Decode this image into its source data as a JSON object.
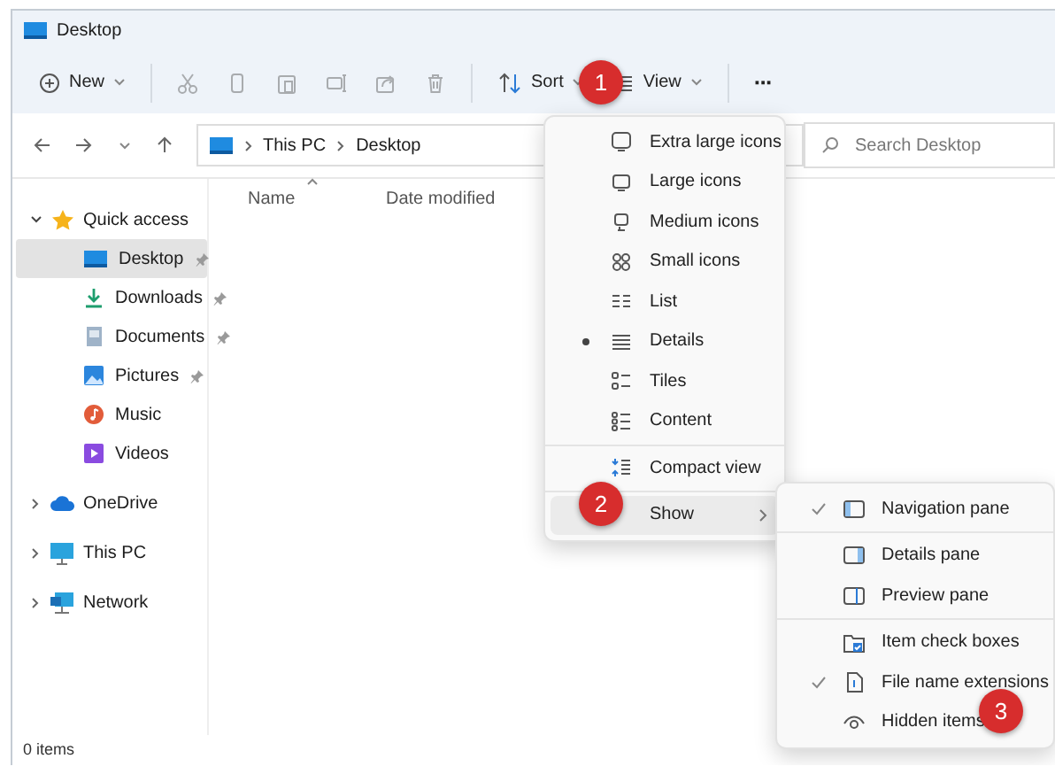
{
  "window": {
    "title": "Desktop"
  },
  "toolbar": [
    {
      "kind": "new",
      "label": "New",
      "disabled": false
    },
    {
      "kind": "cut",
      "disabled": true
    },
    {
      "kind": "copy",
      "disabled": true
    },
    {
      "kind": "paste",
      "disabled": true
    },
    {
      "kind": "rename",
      "disabled": true
    },
    {
      "kind": "share",
      "disabled": true
    },
    {
      "kind": "delete",
      "disabled": true
    },
    {
      "kind": "sort",
      "label": "Sort",
      "disabled": false
    },
    {
      "kind": "view",
      "label": "View",
      "disabled": false
    },
    {
      "kind": "more",
      "label": "···",
      "disabled": false
    }
  ],
  "address": {
    "path": [
      "This PC",
      "Desktop"
    ]
  },
  "search": {
    "placeholder": "Search Desktop"
  },
  "sidebar": {
    "items": [
      {
        "label": "Quick access",
        "expanded": true,
        "children": [
          {
            "label": "Desktop",
            "selected": true,
            "pinned": true
          },
          {
            "label": "Downloads",
            "selected": false,
            "pinned": true
          },
          {
            "label": "Documents",
            "selected": false,
            "pinned": true
          },
          {
            "label": "Pictures",
            "selected": false,
            "pinned": true
          },
          {
            "label": "Music",
            "selected": false,
            "pinned": false
          },
          {
            "label": "Videos",
            "selected": false,
            "pinned": false
          }
        ]
      },
      {
        "label": "OneDrive",
        "expanded": false
      },
      {
        "label": "This PC",
        "expanded": false
      },
      {
        "label": "Network",
        "expanded": false
      }
    ]
  },
  "columns": [
    "Name",
    "Date modified"
  ],
  "view_menu": {
    "layouts": [
      {
        "label": "Extra large icons",
        "selected": false
      },
      {
        "label": "Large icons",
        "selected": false
      },
      {
        "label": "Medium icons",
        "selected": false
      },
      {
        "label": "Small icons",
        "selected": false
      },
      {
        "label": "List",
        "selected": false
      },
      {
        "label": "Details",
        "selected": true
      },
      {
        "label": "Tiles",
        "selected": false
      },
      {
        "label": "Content",
        "selected": false
      }
    ],
    "compact": {
      "label": "Compact view"
    },
    "show": {
      "label": "Show",
      "expanded": true
    }
  },
  "show_menu": {
    "groups": [
      [
        {
          "label": "Navigation pane",
          "checked": true
        }
      ],
      [
        {
          "label": "Details pane",
          "checked": false
        },
        {
          "label": "Preview pane",
          "checked": false
        }
      ],
      [
        {
          "label": "Item check boxes",
          "checked": false
        },
        {
          "label": "File name extensions",
          "checked": true
        },
        {
          "label": "Hidden items",
          "checked": false
        }
      ]
    ]
  },
  "status_bar": "0 items",
  "steps": [
    {
      "label": "1"
    },
    {
      "label": "2"
    },
    {
      "label": "3"
    }
  ]
}
